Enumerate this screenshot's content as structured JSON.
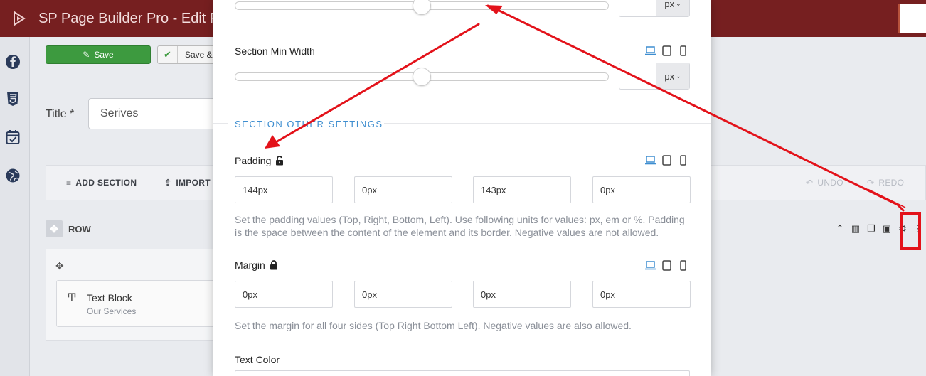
{
  "app": {
    "title": "SP Page Builder Pro - Edit P"
  },
  "left_rail": {
    "icons": [
      "facebook-icon",
      "css3-icon",
      "calendar-check-icon",
      "globe-icon"
    ]
  },
  "actions": {
    "save_label": "Save",
    "save_close_label": "Save &"
  },
  "page_form": {
    "title_label": "Title *",
    "title_value": "Serives"
  },
  "builder_toolbar": {
    "add_section": "ADD SECTION",
    "import": "IMPORT",
    "undo": "UNDO",
    "redo": "REDO"
  },
  "row": {
    "label": "ROW",
    "addon_title": "Text Block",
    "addon_subtitle": "Our Services"
  },
  "modal": {
    "top_unit": "px",
    "min_width_label": "Section Min Width",
    "min_width_unit": "px",
    "other_settings_heading": "SECTION OTHER SETTINGS",
    "padding": {
      "label": "Padding",
      "values": [
        "144px",
        "0px",
        "143px",
        "0px"
      ],
      "help": "Set the padding values (Top, Right, Bottom, Left). Use following units for values: px, em or %. Padding is the space between the content of the element and its border. Negative values are not allowed."
    },
    "margin": {
      "label": "Margin",
      "values": [
        "0px",
        "0px",
        "0px",
        "0px"
      ],
      "help": "Set the margin for all four sides (Top Right Bottom Left). Negative values are also allowed."
    },
    "text_color_label": "Text Color"
  },
  "colors": {
    "topbar": "#761f20",
    "accent_blue": "#3e8ed0",
    "save_green": "#3d9a3f",
    "annotation_red": "#e3121a"
  }
}
